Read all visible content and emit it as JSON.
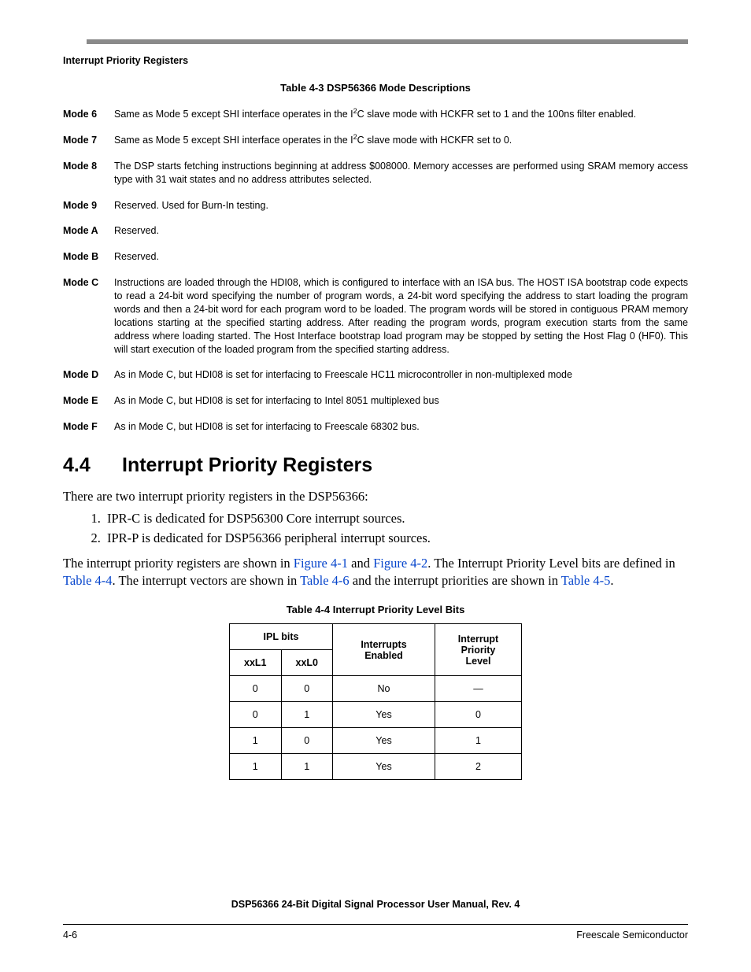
{
  "running_head": "Interrupt Priority Registers",
  "table43_caption": "Table 4-3   DSP56366 Mode Descriptions",
  "modes": [
    {
      "label": "Mode 6",
      "desc_html": "Same as Mode 5 except SHI interface operates in the I<sup>2</sup>C slave mode with HCKFR set to 1 and the 100ns filter enabled."
    },
    {
      "label": "Mode 7",
      "desc_html": "Same as Mode 5 except SHI interface operates in the I<sup>2</sup>C slave mode with HCKFR set to 0."
    },
    {
      "label": "Mode 8",
      "desc_html": "The DSP starts fetching instructions beginning at address $008000. Memory accesses are performed using SRAM memory access type with 31 wait states and no address attributes selected."
    },
    {
      "label": "Mode 9",
      "desc_html": "Reserved. Used for Burn-In testing."
    },
    {
      "label": "Mode A",
      "desc_html": "Reserved."
    },
    {
      "label": "Mode B",
      "desc_html": "Reserved."
    },
    {
      "label": "Mode C",
      "desc_html": "Instructions are loaded through the HDI08, which is configured to interface with an ISA bus. The HOST ISA bootstrap code expects to read a 24-bit word specifying the number of program words, a 24-bit word specifying the address to start loading the program words and then a 24-bit word for each program word to be loaded. The program words will be stored in contiguous PRAM memory locations starting at the specified starting address. After reading the program words, program execution starts from the same address where loading started. The Host Interface bootstrap load program may be stopped by setting the Host Flag 0 (HF0). This will start execution of the loaded program from the specified starting address."
    },
    {
      "label": "Mode D",
      "desc_html": "As in Mode C, but HDI08 is set for interfacing to Freescale HC11 microcontroller in non-multiplexed mode"
    },
    {
      "label": "Mode E",
      "desc_html": "As in Mode C, but HDI08 is set for interfacing to Intel 8051 multiplexed bus"
    },
    {
      "label": "Mode F",
      "desc_html": "As in Mode C, but HDI08 is set for interfacing to Freescale 68302 bus."
    }
  ],
  "section": {
    "num": "4.4",
    "title": "Interrupt Priority Registers"
  },
  "body": {
    "p1": "There are two interrupt priority registers in the DSP56366:",
    "list": [
      "IPR-C is dedicated for DSP56300 Core interrupt sources.",
      "IPR-P is dedicated for DSP56366 peripheral interrupt sources."
    ],
    "p2_pre": "The interrupt priority registers are shown in ",
    "xref1": "Figure 4-1",
    "p2_mid1": " and ",
    "xref2": "Figure 4-2",
    "p2_mid2": ". The Interrupt Priority Level bits are defined in ",
    "xref3": "Table 4-4",
    "p2_mid3": ". The interrupt vectors are shown in ",
    "xref4": "Table 4-6",
    "p2_mid4": " and the interrupt priorities are shown in ",
    "xref5": "Table 4-5",
    "p2_post": "."
  },
  "table44_caption": "Table 4-4   Interrupt Priority Level Bits",
  "ipl": {
    "headers": {
      "group": "IPL bits",
      "xxL1": "xxL1",
      "xxL0": "xxL0",
      "interrupts": "Interrupts Enabled",
      "priority": "Interrupt Priority Level"
    },
    "rows": [
      {
        "l1": "0",
        "l0": "0",
        "en": "No",
        "pl": "—"
      },
      {
        "l1": "0",
        "l0": "1",
        "en": "Yes",
        "pl": "0"
      },
      {
        "l1": "1",
        "l0": "0",
        "en": "Yes",
        "pl": "1"
      },
      {
        "l1": "1",
        "l0": "1",
        "en": "Yes",
        "pl": "2"
      }
    ]
  },
  "footer": {
    "title": "DSP56366 24-Bit Digital Signal Processor User Manual, Rev. 4",
    "left": "4-6",
    "right": "Freescale Semiconductor"
  }
}
